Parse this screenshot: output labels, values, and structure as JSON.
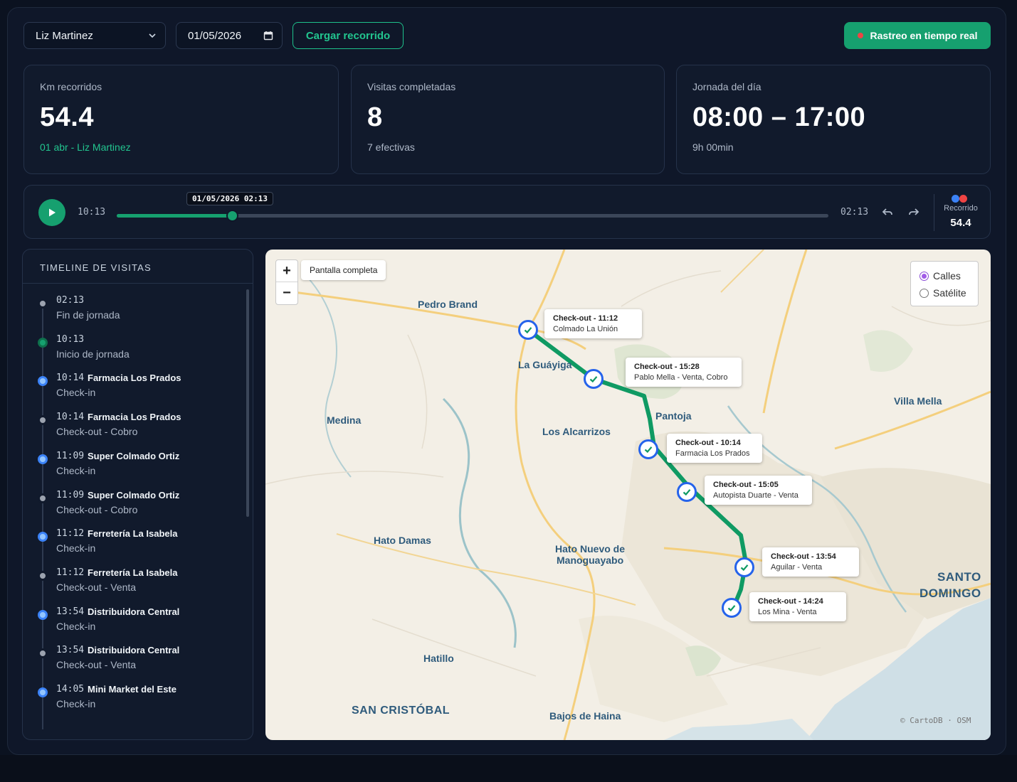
{
  "toolbar": {
    "agent_select": "Liz Martinez",
    "date_value": "01/05/2026",
    "load_label": "Cargar recorrido",
    "live_label": "Rastreo en tiempo real"
  },
  "stats": [
    {
      "label": "Km recorridos",
      "value": "54.4",
      "sub": "01 abr - Liz Martinez"
    },
    {
      "label": "Visitas completadas",
      "value": "8",
      "sub": "7 efectivas"
    },
    {
      "label": "Jornada del día",
      "value": "08:00 – 17:00",
      "sub": "9h 00min"
    }
  ],
  "player": {
    "start_time": "10:13",
    "end_time": "02:13",
    "tooltip": "01/05/2026 02:13",
    "progress": 0.162,
    "recorrido_label": "Recorrido",
    "recorrido_value": "54.4"
  },
  "colors": {
    "accent": "#16a06f",
    "legend_blue": "#3b82f6",
    "legend_red": "#ef4444",
    "route": "#0f9a63",
    "marker": "#2563eb"
  },
  "timeline": {
    "title": "TIMELINE DE VISITAS",
    "items": [
      {
        "time": "02:13",
        "name": "",
        "sub": "Fin de jornada",
        "kind": "end"
      },
      {
        "time": "10:13",
        "name": "",
        "sub": "Inicio de jornada",
        "kind": "start"
      },
      {
        "time": "10:14",
        "name": "Farmacia Los Prados",
        "sub": "Check-in",
        "kind": "checkin"
      },
      {
        "time": "10:14",
        "name": "Farmacia Los Prados",
        "sub": "Check-out - Cobro",
        "kind": "checkout"
      },
      {
        "time": "11:09",
        "name": "Super Colmado Ortiz",
        "sub": "Check-in",
        "kind": "checkin"
      },
      {
        "time": "11:09",
        "name": "Super Colmado Ortiz",
        "sub": "Check-out - Cobro",
        "kind": "checkout"
      },
      {
        "time": "11:12",
        "name": "Ferretería La Isabela",
        "sub": "Check-in",
        "kind": "checkin"
      },
      {
        "time": "11:12",
        "name": "Ferretería La Isabela",
        "sub": "Check-out - Venta",
        "kind": "checkout"
      },
      {
        "time": "13:54",
        "name": "Distribuidora Central",
        "sub": "Check-in",
        "kind": "checkin"
      },
      {
        "time": "13:54",
        "name": "Distribuidora Central",
        "sub": "Check-out - Venta",
        "kind": "checkout"
      },
      {
        "time": "14:05",
        "name": "Mini Market del Este",
        "sub": "Check-in",
        "kind": "checkin"
      }
    ]
  },
  "map": {
    "fullscreen_label": "Pantalla completa",
    "zoom_in": "+",
    "zoom_out": "−",
    "layer_streets": "Calles",
    "layer_satellite": "Satélite",
    "attribution": "© CartoDB · OSM",
    "places": [
      "Pedro Brand",
      "La Guáyiga",
      "Pantoja",
      "Villa Mella",
      "Medina",
      "Los Alcarrizos",
      "Hato Damas",
      "Hato Nuevo de",
      "Manoguayabo",
      "SANTO",
      "DOMINGO",
      "Hatillo",
      "SAN CRISTÓBAL",
      "Bajos de Haina"
    ],
    "popups": [
      {
        "title": "Check-out - 11:12",
        "desc": "Colmado La Unión"
      },
      {
        "title": "Check-out - 15:28",
        "desc": "Pablo Mella - Venta, Cobro"
      },
      {
        "title": "Check-out - 10:14",
        "desc": "Farmacia Los Prados"
      },
      {
        "title": "Check-out - 15:05",
        "desc": "Autopista Duarte - Venta"
      },
      {
        "title": "Check-out - 13:54",
        "desc": "Aguilar - Venta"
      },
      {
        "title": "Check-out - 14:24",
        "desc": "Los Mina - Venta"
      }
    ]
  }
}
